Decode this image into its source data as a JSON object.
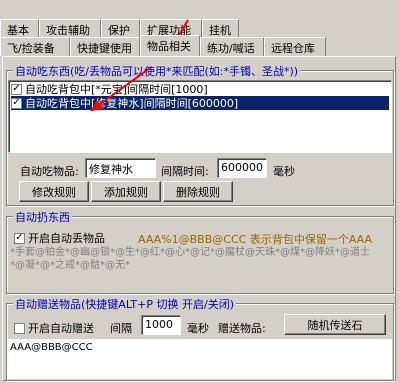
{
  "tabs_row1": [
    {
      "label": "基本",
      "active": false
    },
    {
      "label": "攻击辅助",
      "active": false
    },
    {
      "label": "保护",
      "active": false
    },
    {
      "label": "扩展功能",
      "active": true
    },
    {
      "label": "挂机",
      "active": false
    }
  ],
  "tabs_row2": [
    {
      "label": "飞/捡装备",
      "active": false
    },
    {
      "label": "快捷键使用",
      "active": false
    },
    {
      "label": "物品相关",
      "active": true
    },
    {
      "label": "练功/喊话",
      "active": false
    },
    {
      "label": "远程仓库",
      "active": false
    }
  ],
  "auto_eat": {
    "title": "自动吃东西",
    "title_note": "(吃/丢物品可以使用*来匹配(如:*手镯、圣战*))",
    "rows": [
      {
        "checked": true,
        "text": "自动吃背包中[*元宝]间隔时间[1000]",
        "selected": false
      },
      {
        "checked": true,
        "text": "自动吃背包中[修复神水]间隔时间[600000]",
        "selected": true
      }
    ],
    "item_label": "自动吃物品:",
    "item_value": "修复神水",
    "interval_label": "间隔时间:",
    "interval_value": "600000",
    "unit": "毫秒",
    "buttons": [
      "修改规则",
      "添加规则",
      "删除规则"
    ]
  },
  "auto_drop": {
    "title": "自动扔东西",
    "checkbox_label": "开启自动丢物品",
    "checked": true,
    "hint": "AAA%1@BBB@CCC 表示背包中保留一个AAA",
    "memo": "*手套@铂金*@幽@银*@生*@红*@心*@记*@魔杖@天珠*@煤*@降妖*@道士\n*@凝*@*之戒*@骷*@无*"
  },
  "auto_give": {
    "title": "自动赠送物品",
    "title_note": "(快捷键ALT+P  切换  开启/关闭)",
    "checkbox_label": "开启自动赠送",
    "checked": false,
    "interval_label": "间隔",
    "interval_value": "1000",
    "unit": "毫秒",
    "item_label": "赠送物品:",
    "item_button": "随机传送石",
    "memo": "AAA@BBB@CCC"
  },
  "colors": {
    "accent": "#0000c0",
    "selection": "#0a246a",
    "arrow": "#ff0000"
  }
}
